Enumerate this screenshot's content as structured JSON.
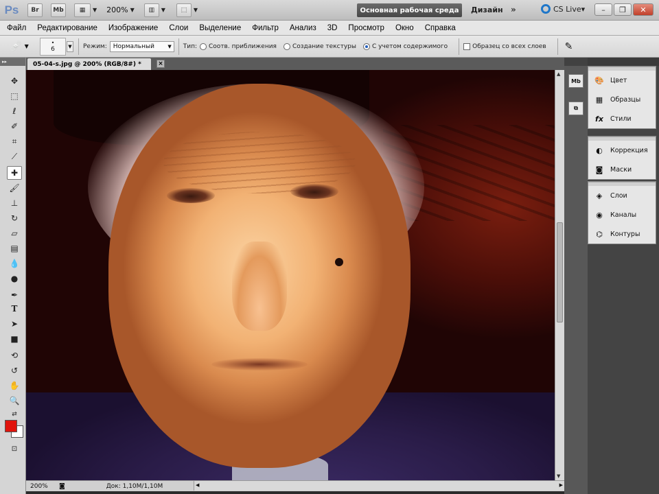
{
  "appbar": {
    "logo": "Ps",
    "bridge_label": "Br",
    "minibridge_label": "Mb",
    "zoom_value": "200%",
    "workspace_label": "Основная рабочая среда",
    "design_label": "Дизайн",
    "more_label": "»",
    "cslive_label": "CS Live▾",
    "min_label": "–",
    "restore_label": "❐",
    "close_label": "✕"
  },
  "menubar": {
    "items": [
      "Файл",
      "Редактирование",
      "Изображение",
      "Слои",
      "Выделение",
      "Фильтр",
      "Анализ",
      "3D",
      "Просмотр",
      "Окно",
      "Справка"
    ]
  },
  "options": {
    "brush_size": "6",
    "mode_label": "Режим:",
    "mode_value": "Нормальный",
    "type_label": "Тип:",
    "type_options": [
      {
        "label": "Соотв. приближения",
        "checked": false
      },
      {
        "label": "Создание текстуры",
        "checked": false
      },
      {
        "label": "С учетом содержимого",
        "checked": true
      }
    ],
    "sample_all_layers": "Образец со всех слоев"
  },
  "document": {
    "tab_title": "05-04-s.jpg @ 200% (RGB/8#) *",
    "close": "×"
  },
  "status": {
    "zoom": "200%",
    "doc_info": "Док: 1,10M/1,10M"
  },
  "panels": {
    "group1": [
      "Цвет",
      "Образцы",
      "Стили"
    ],
    "group2": [
      "Коррекция",
      "Маски"
    ],
    "group3": [
      "Слои",
      "Каналы",
      "Контуры"
    ]
  },
  "colors": {
    "foreground": "#e0140d",
    "background": "#ffffff",
    "accent": "#1f77c9"
  }
}
